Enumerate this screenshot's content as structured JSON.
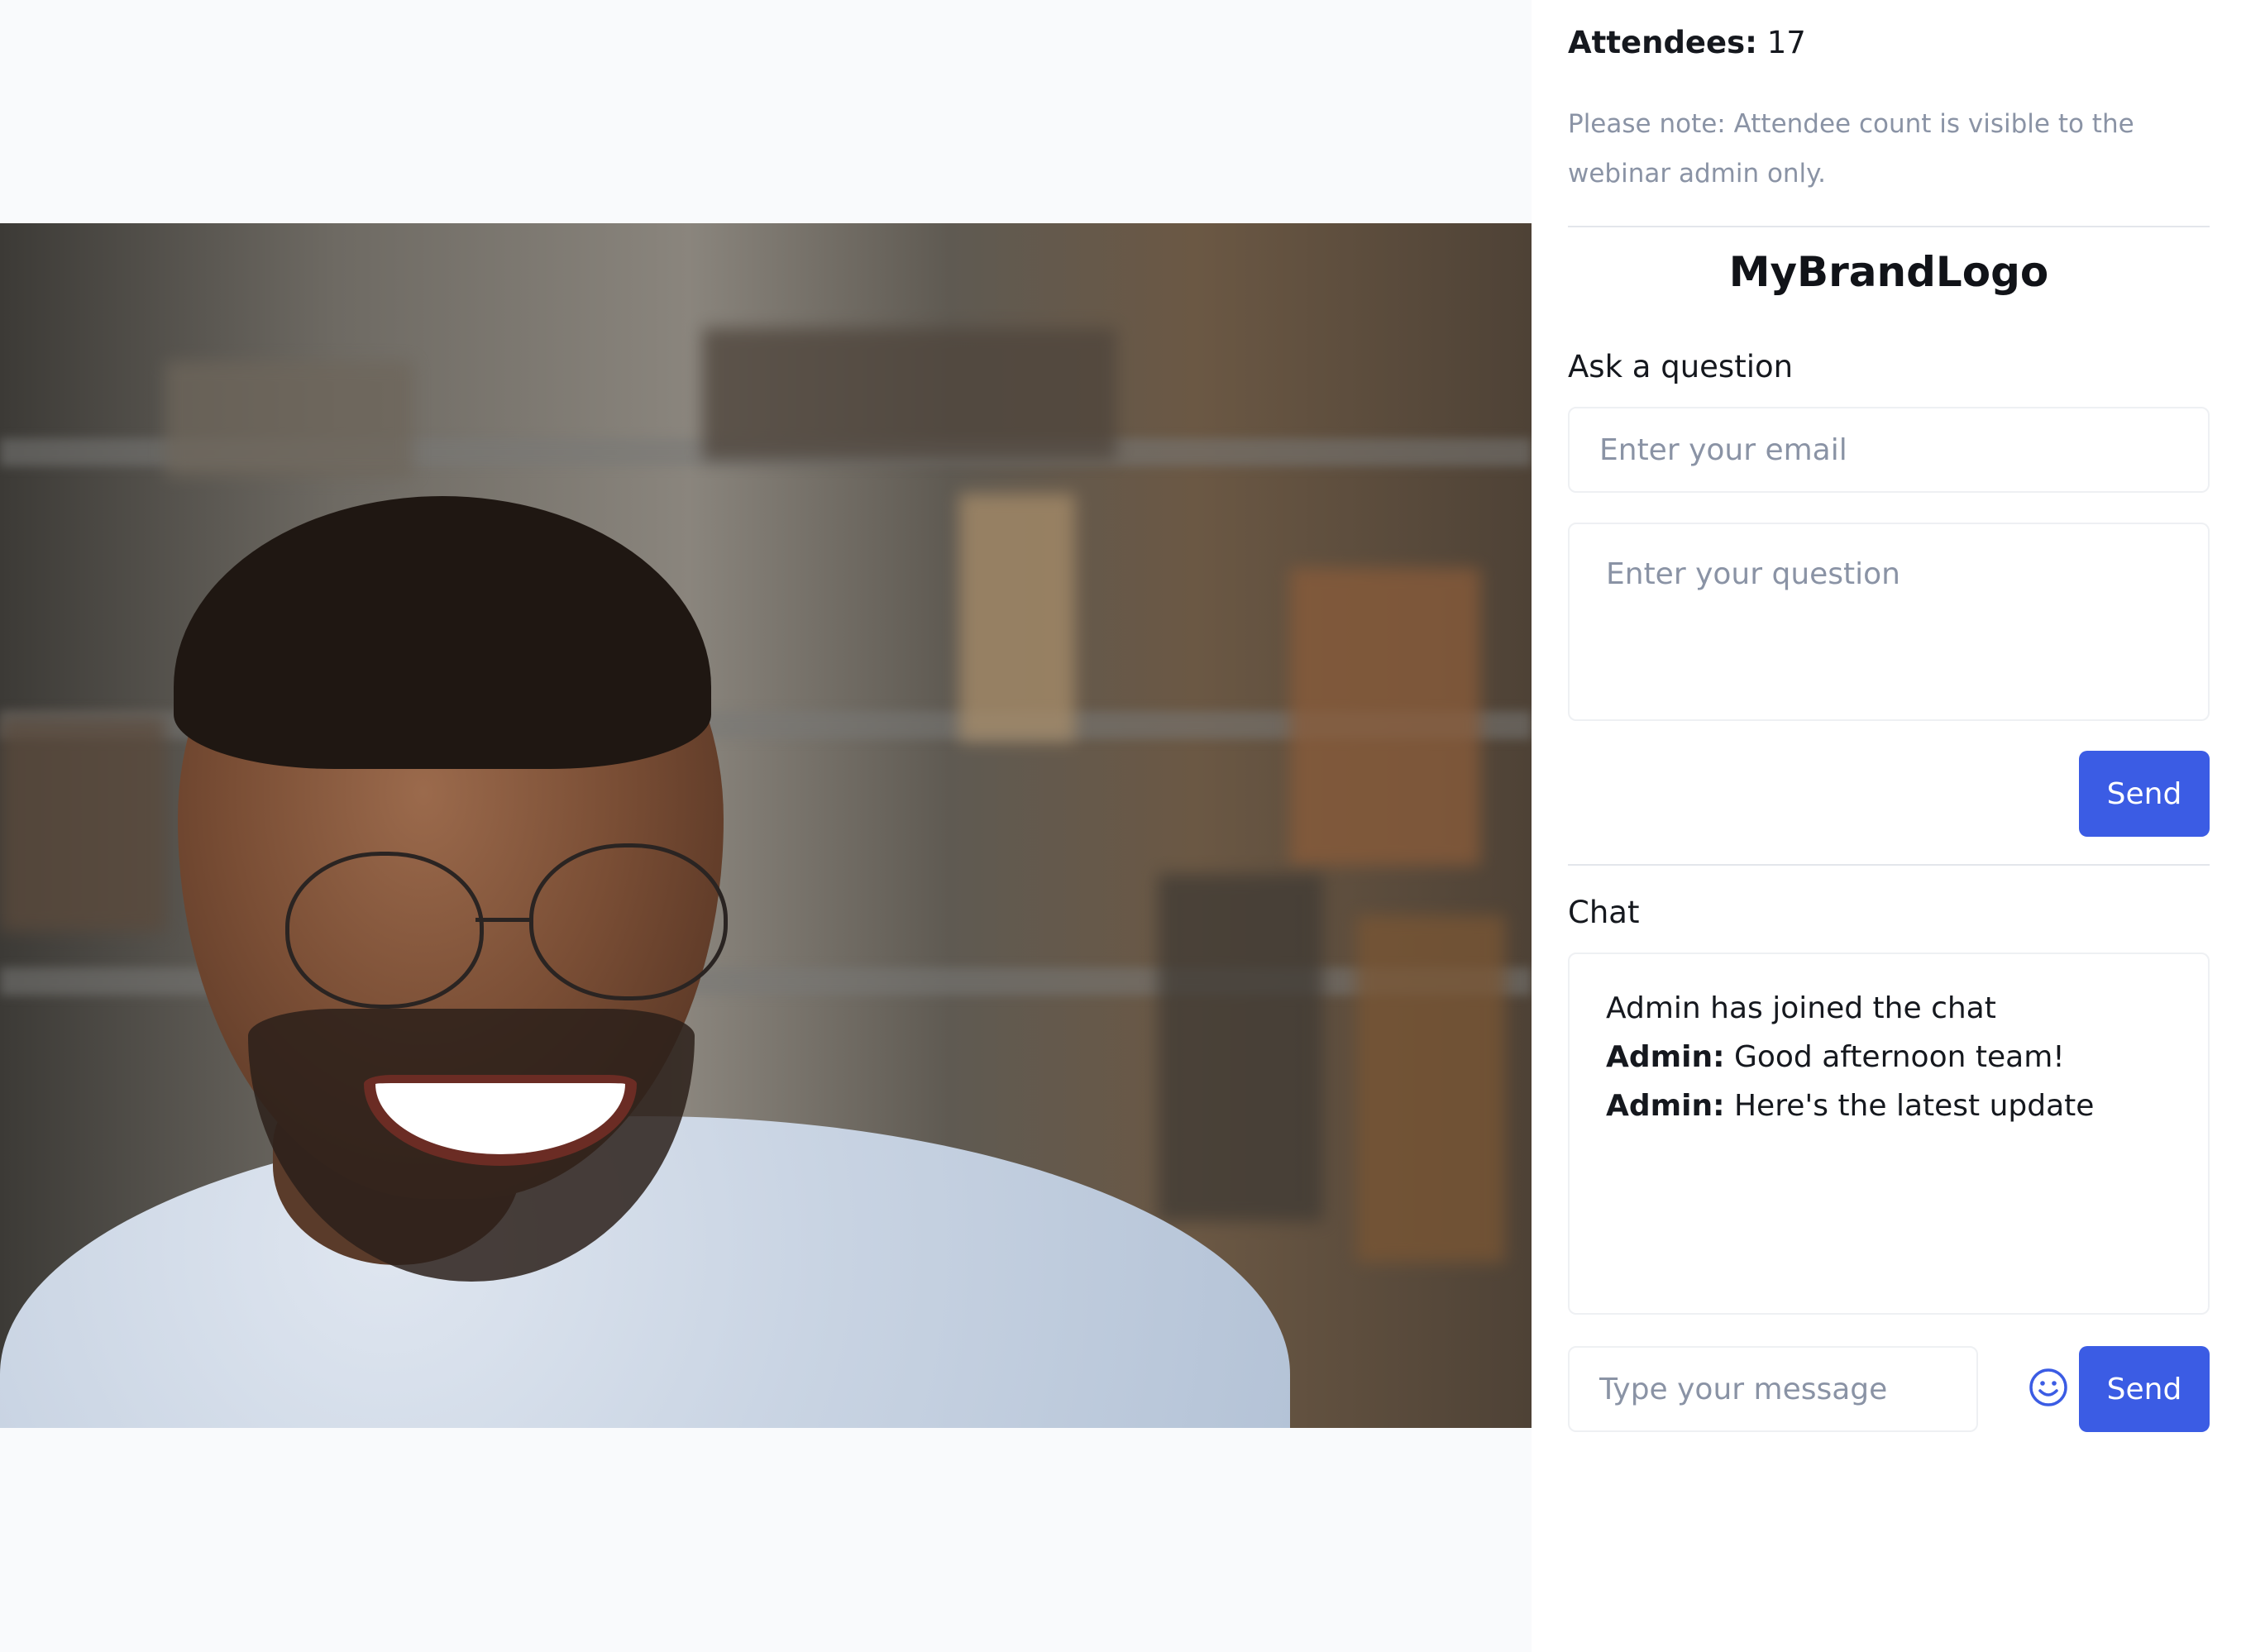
{
  "sidebar": {
    "attendees_label": "Attendees:",
    "attendees_count": "17",
    "note": "Please note: Attendee count is visible to the webinar admin only.",
    "brand_logo": "MyBrandLogo",
    "question": {
      "heading": "Ask a question",
      "email_placeholder": "Enter your email",
      "question_placeholder": "Enter your question",
      "send_label": "Send"
    },
    "chat": {
      "heading": "Chat",
      "system_message": "Admin has joined the chat",
      "messages": [
        {
          "author": "Admin:",
          "text": "Good afternoon team!"
        },
        {
          "author": "Admin:",
          "text": "Here's the latest update"
        }
      ],
      "input_placeholder": "Type your message",
      "send_label": "Send"
    }
  },
  "video": {
    "volume_icon": "speaker-volume-icon"
  },
  "colors": {
    "accent": "#3b5ce4",
    "muted_text": "#8a93a5",
    "page_background": "#f9fafc"
  }
}
